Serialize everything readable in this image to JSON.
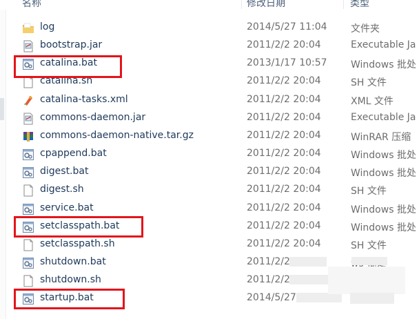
{
  "header": {
    "name": "名称",
    "date": "修改日期",
    "type": "类型"
  },
  "files": [
    {
      "name": "log",
      "date": "2014/5/27 11:04",
      "type": "文件夹",
      "icon": "folder-icon",
      "highlighted": false
    },
    {
      "name": "bootstrap.jar",
      "date": "2011/2/2 20:04",
      "type": "Executable Ja",
      "icon": "jar-icon",
      "highlighted": false
    },
    {
      "name": "catalina.bat",
      "date": "2013/1/17 10:57",
      "type": "Windows 批处",
      "icon": "batch-file-icon",
      "highlighted": true
    },
    {
      "name": "catalina.sh",
      "date": "2011/2/2 20:04",
      "type": "SH 文件",
      "icon": "blank-file-icon",
      "highlighted": false
    },
    {
      "name": "catalina-tasks.xml",
      "date": "2011/2/2 20:04",
      "type": "XML 文件",
      "icon": "xml-file-icon",
      "highlighted": false
    },
    {
      "name": "commons-daemon.jar",
      "date": "2011/2/2 20:04",
      "type": "Executable Ja",
      "icon": "jar-icon",
      "highlighted": false
    },
    {
      "name": "commons-daemon-native.tar.gz",
      "date": "2011/2/2 20:04",
      "type": "WinRAR 压缩",
      "icon": "archive-icon",
      "highlighted": false
    },
    {
      "name": "cpappend.bat",
      "date": "2011/2/2 20:04",
      "type": "Windows 批处",
      "icon": "batch-file-icon",
      "highlighted": false
    },
    {
      "name": "digest.bat",
      "date": "2011/2/2 20:04",
      "type": "Windows 批处",
      "icon": "batch-file-icon",
      "highlighted": false
    },
    {
      "name": "digest.sh",
      "date": "2011/2/2 20:04",
      "type": "SH 文件",
      "icon": "blank-file-icon",
      "highlighted": false
    },
    {
      "name": "service.bat",
      "date": "2011/2/2 20:04",
      "type": "Windows 批处",
      "icon": "batch-file-icon",
      "highlighted": false
    },
    {
      "name": "setclasspath.bat",
      "date": "2011/2/2 20:04",
      "type": "Windows 批处",
      "icon": "batch-file-icon",
      "highlighted": true
    },
    {
      "name": "setclasspath.sh",
      "date": "2011/2/2 20:04",
      "type": "SH 文件",
      "icon": "blank-file-icon",
      "highlighted": false
    },
    {
      "name": "shutdown.bat",
      "date": "2011/2/2 2",
      "type": "ws 批处",
      "icon": "batch-file-icon",
      "highlighted": false
    },
    {
      "name": "shutdown.sh",
      "date": "2011/2/2",
      "type": "",
      "icon": "blank-file-icon",
      "highlighted": false
    },
    {
      "name": "startup.bat",
      "date": "2014/5/27",
      "type": "s 批处",
      "icon": "batch-file-icon",
      "highlighted": true
    }
  ],
  "colors": {
    "highlight": "#e3141b",
    "name_text": "#1e395b",
    "detail_text": "#6d6d6d"
  }
}
